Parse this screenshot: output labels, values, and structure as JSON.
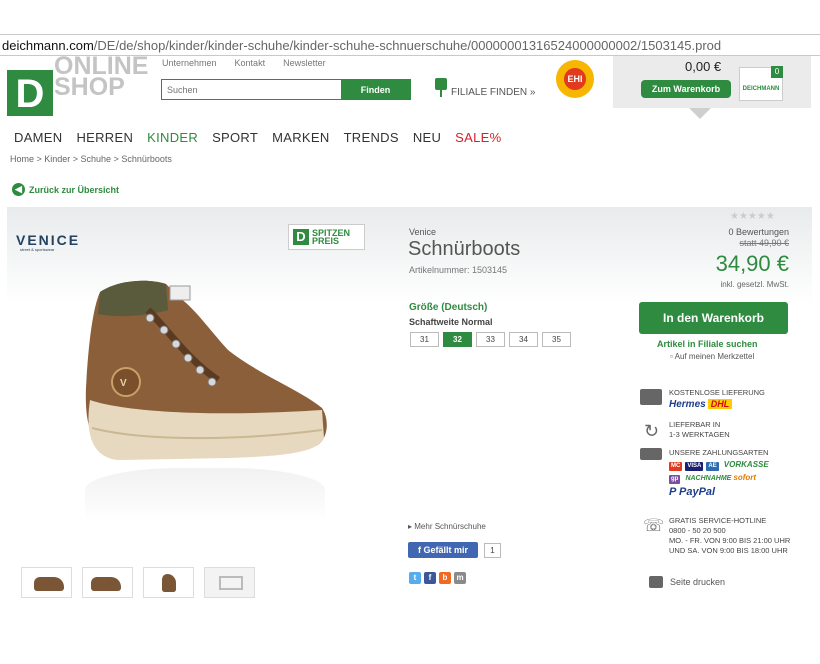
{
  "browser": {
    "url_domain": "deichmann.com",
    "url_path": "/DE/de/shop/kinder/kinder-schuhe/kinder-schuhe-schnuerschuhe/00000001316524000000002/1503145.prod"
  },
  "header": {
    "logo_letter": "D",
    "logo_line1": "ONLINE",
    "logo_line2": "SHOP",
    "top_links": [
      "Unternehmen",
      "Kontakt",
      "Newsletter"
    ],
    "search_placeholder": "Suchen",
    "search_button": "Finden",
    "filiale_label": "FILIALE FINDEN »",
    "ehi_label": "EHI",
    "cart_price": "0,00 €",
    "cart_button": "Zum Warenkorb",
    "cart_count": "0",
    "cart_bag_text": "DEICHMANN"
  },
  "nav": {
    "items": [
      "DAMEN",
      "HERREN",
      "KINDER",
      "SPORT",
      "MARKEN",
      "TRENDS",
      "NEU",
      "SALE%"
    ]
  },
  "breadcrumb": "Home > Kinder > Schuhe > Schnürboots",
  "back_link": "Zurück zur Übersicht",
  "product": {
    "brand_logo": "VENICE",
    "brand_logo_sub": "street & sportswear",
    "badge_line1": "SPITZEN",
    "badge_line2": "PREIS",
    "brand": "Venice",
    "title": "Schnürboots",
    "article_number": "Artikelnummer: 1503145",
    "stars": "★★★★★",
    "ratings": "0 Bewertungen",
    "old_price": "statt 49,90 €",
    "price": "34,90 €",
    "tax_note": "inkl. gesetzl. MwSt.",
    "size_label": "Größe (Deutsch)",
    "shaft": "Schaftweite Normal",
    "sizes": [
      "31",
      "32",
      "33",
      "34",
      "35"
    ],
    "selected_size": "32",
    "add_to_cart": "In den Warenkorb",
    "filiale_search": "Artikel in Filiale suchen",
    "wishlist": "Auf meinen Merkzettel",
    "more_link": "Mehr Schnürschuhe",
    "fb_like": "Gefällt mir",
    "fb_count": "1",
    "print_label": "Seite drucken"
  },
  "features": {
    "shipping_title": "KOSTENLOSE LIEFERUNG",
    "hermes": "Hermes",
    "dhl": "DHL",
    "delivery_line1": "LIEFERBAR IN",
    "delivery_line2": "1-3 WERKTAGEN",
    "payment_title": "UNSERE ZAHLUNGSARTEN",
    "pay_visa": "VISA",
    "pay_vorkasse": "VORKASSE",
    "pay_nachnahme": "NACHNAHME",
    "pay_sofort": "sofort",
    "pay_paypal": "PayPal",
    "hotline_title": "GRATIS SERVICE-HOTLINE",
    "hotline_number": "0800 - 50 20 500",
    "hotline_hours": "MO. - FR. VON 9:00 BIS 21:00 UHR UND SA. VON 9:00 BIS 18:00 UHR"
  },
  "colors": {
    "brand_green": "#2e8b3f",
    "sale_red": "#d2232a"
  }
}
